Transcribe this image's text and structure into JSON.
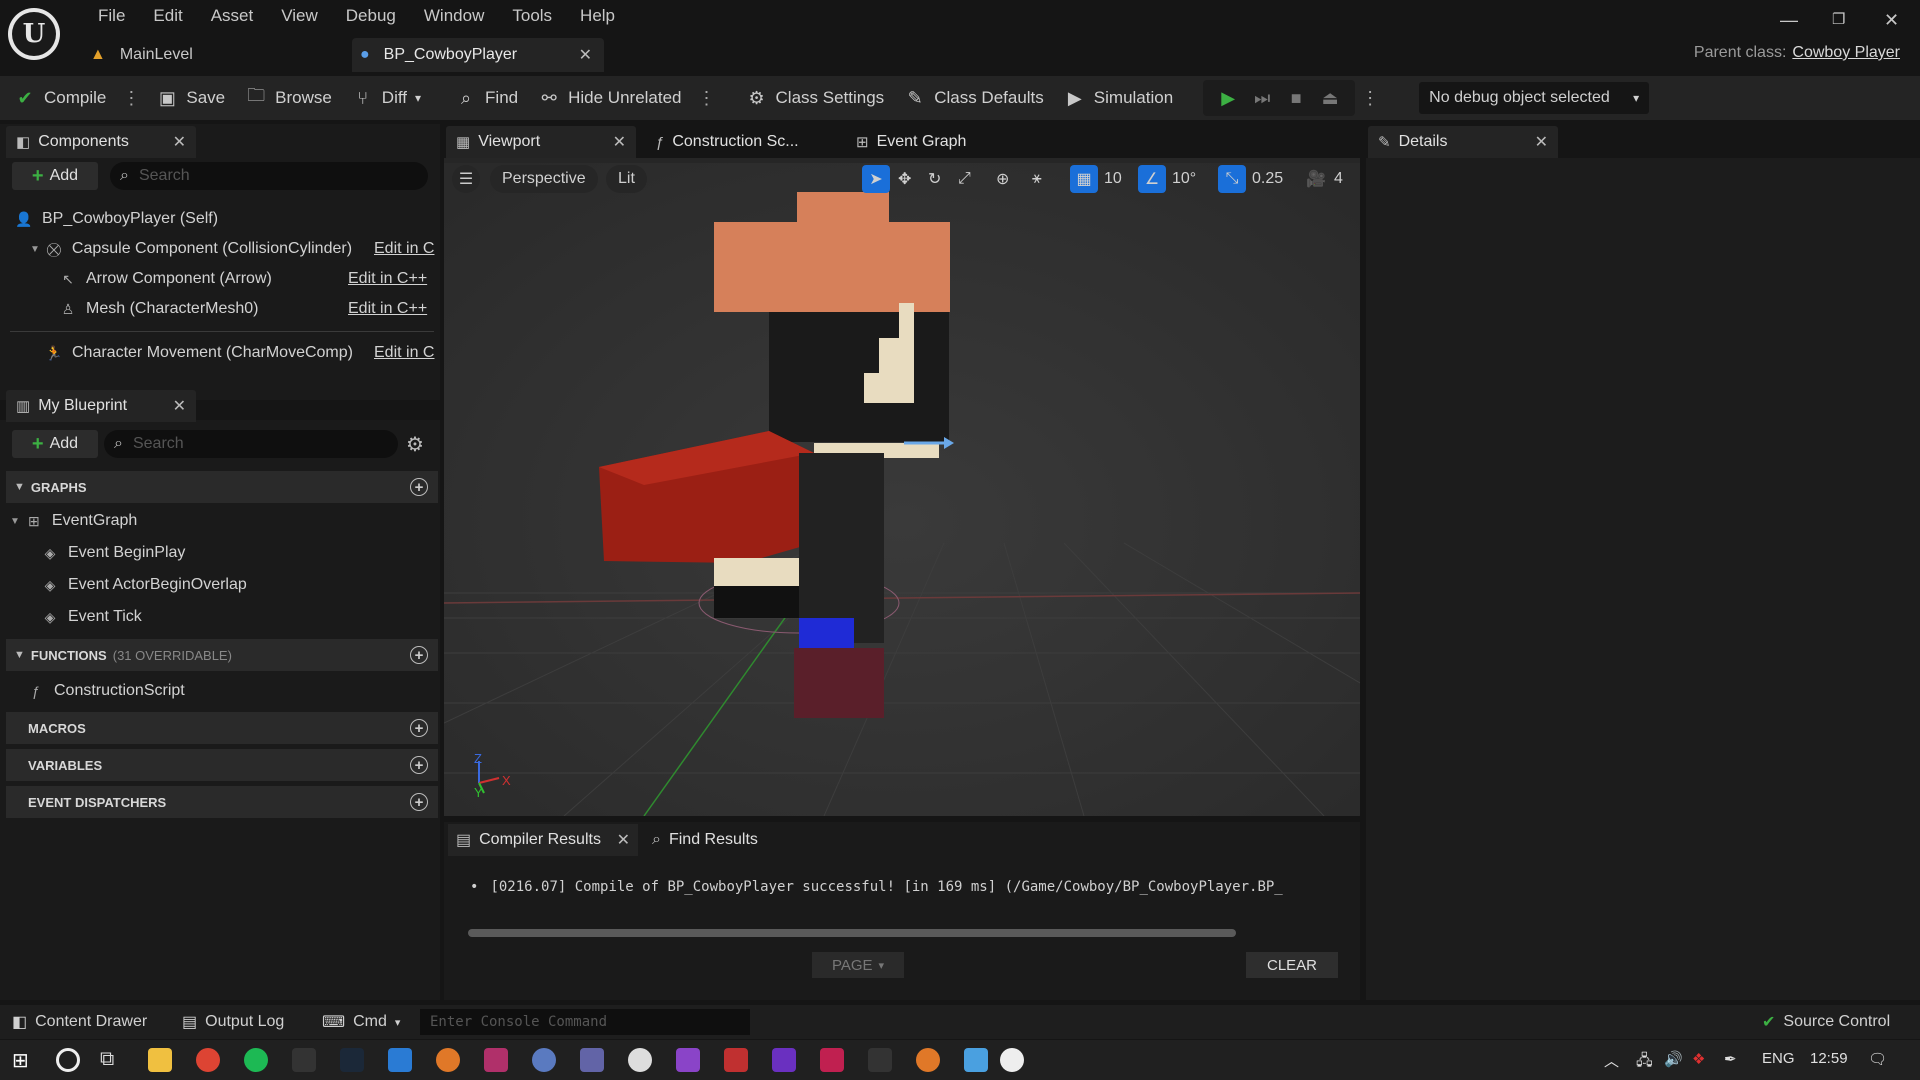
{
  "menubar": [
    "File",
    "Edit",
    "Asset",
    "View",
    "Debug",
    "Window",
    "Tools",
    "Help"
  ],
  "doc_tabs": {
    "main_level": "MainLevel",
    "blueprint": "BP_CowboyPlayer"
  },
  "parent_class": {
    "label": "Parent class:",
    "value": "Cowboy Player"
  },
  "toolbar": {
    "compile": "Compile",
    "save": "Save",
    "browse": "Browse",
    "diff": "Diff",
    "find": "Find",
    "hide_unrelated": "Hide Unrelated",
    "class_settings": "Class Settings",
    "class_defaults": "Class Defaults",
    "simulation": "Simulation",
    "debug_object": "No debug object selected"
  },
  "components": {
    "tab": "Components",
    "add": "Add",
    "search_placeholder": "Search",
    "items": [
      {
        "label": "BP_CowboyPlayer (Self)"
      },
      {
        "label": "Capsule Component (CollisionCylinder)",
        "edit": "Edit in C"
      },
      {
        "label": "Arrow Component (Arrow)",
        "edit": "Edit in C++"
      },
      {
        "label": "Mesh (CharacterMesh0)",
        "edit": "Edit in C++"
      },
      {
        "label": "Character Movement (CharMoveComp)",
        "edit": "Edit in C"
      }
    ]
  },
  "my_blueprint": {
    "tab": "My Blueprint",
    "add": "Add",
    "search_placeholder": "Search",
    "graphs_header": "GRAPHS",
    "event_graph": "EventGraph",
    "events": [
      "Event BeginPlay",
      "Event ActorBeginOverlap",
      "Event Tick"
    ],
    "functions_header": "FUNCTIONS",
    "functions_count": "(31 OVERRIDABLE)",
    "construction_script": "ConstructionScript",
    "macros_header": "MACROS",
    "variables_header": "VARIABLES",
    "dispatchers_header": "EVENT DISPATCHERS"
  },
  "editor_tabs": {
    "viewport": "Viewport",
    "construction": "Construction Sc...",
    "event_graph": "Event Graph"
  },
  "viewport": {
    "perspective": "Perspective",
    "lit": "Lit",
    "grid_snap": "10",
    "rot_snap": "10°",
    "scale_snap": "0.25",
    "cam_speed": "4",
    "axis": {
      "z": "Z",
      "y": "Y",
      "x": "X"
    }
  },
  "details": {
    "tab": "Details"
  },
  "compiler": {
    "tab": "Compiler Results",
    "find_tab": "Find Results",
    "log": "[0216.07] Compile of BP_CowboyPlayer successful! [in 169 ms] (/Game/Cowboy/BP_CowboyPlayer.BP_",
    "page": "PAGE",
    "clear": "CLEAR"
  },
  "statusbar": {
    "content_drawer": "Content Drawer",
    "output_log": "Output Log",
    "cmd": "Cmd",
    "console_placeholder": "Enter Console Command",
    "source_control": "Source Control"
  },
  "taskbar": {
    "lang": "ENG",
    "time": "12:59"
  },
  "colors": {
    "accent_blue": "#1a6fd9",
    "play_green": "#3cb043",
    "hat": "#d6805a",
    "shirt": "#9b1f14"
  }
}
